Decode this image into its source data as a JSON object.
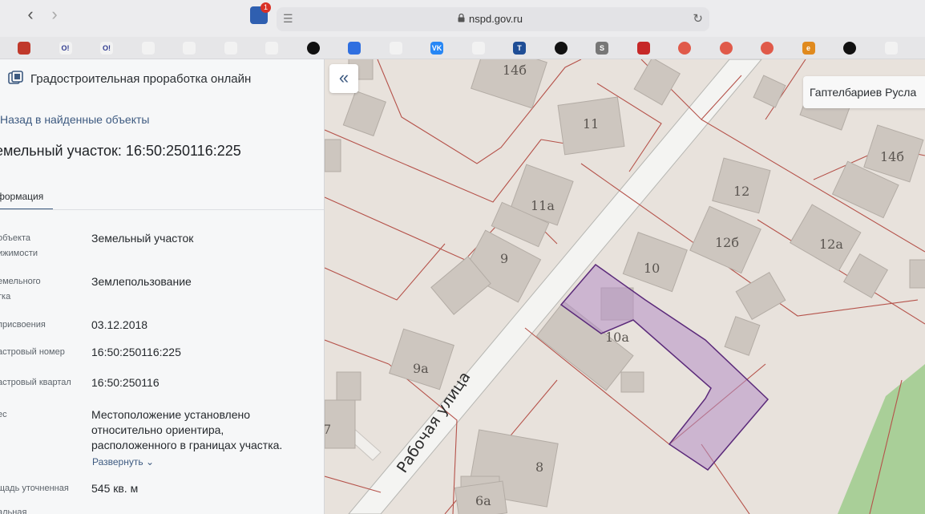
{
  "browser": {
    "url": "nspd.gov.ru",
    "extension_badge": "1",
    "bookmarks": [
      {
        "icon": "red-bookmark-icon",
        "color": "#c0392b",
        "text": ""
      },
      {
        "icon": "ok-icon",
        "color": "#f2f2f2",
        "text": "О!"
      },
      {
        "icon": "ok-green-icon",
        "color": "#f2f2f2",
        "text": "О!"
      },
      {
        "icon": "lambda-blue-icon",
        "color": "#f2f2f2",
        "text": ""
      },
      {
        "icon": "lambda-blue-icon",
        "color": "#f2f2f2",
        "text": ""
      },
      {
        "icon": "dots-colored-icon",
        "color": "#f2f2f2",
        "text": ""
      },
      {
        "icon": "dots-colored-icon",
        "color": "#f2f2f2",
        "text": ""
      },
      {
        "icon": "black-circle-icon",
        "color": "#111111",
        "text": ""
      },
      {
        "icon": "mail-icon",
        "color": "#2f6fe0",
        "text": ""
      },
      {
        "icon": "arrow-icon",
        "color": "#f2f2f2",
        "text": ""
      },
      {
        "icon": "vk-icon",
        "color": "#2787f5",
        "text": "VK"
      },
      {
        "icon": "dots-colored-icon",
        "color": "#f2f2f2",
        "text": ""
      },
      {
        "icon": "t-icon",
        "color": "#1f4e96",
        "text": "T"
      },
      {
        "icon": "black-circle-icon",
        "color": "#111111",
        "text": ""
      },
      {
        "icon": "s-icon",
        "color": "#777777",
        "text": "S"
      },
      {
        "icon": "red-square-icon",
        "color": "#c62828",
        "text": ""
      },
      {
        "icon": "lifebuoy-icon",
        "color": "#e05a4a",
        "text": ""
      },
      {
        "icon": "lifebuoy-icon",
        "color": "#e05a4a",
        "text": ""
      },
      {
        "icon": "lifebuoy-icon",
        "color": "#e05a4a",
        "text": ""
      },
      {
        "icon": "e-icon",
        "color": "#e08a1e",
        "text": "e"
      },
      {
        "icon": "black-circle-icon",
        "color": "#111111",
        "text": ""
      },
      {
        "icon": "arrow-red-icon",
        "color": "#f2f2f2",
        "text": ""
      }
    ]
  },
  "panel": {
    "app_title": "Градостроительная проработка онлайн",
    "back_link": "Назад в найденные объекты",
    "heading": "емельный участок: 16:50:250116:225",
    "tab": "формация",
    "rows": [
      {
        "label": "объекта\nижимости",
        "value": "Земельный участок"
      },
      {
        "label": "емельного\nтка",
        "value": "Землепользование"
      },
      {
        "label": "присвоения",
        "value": "03.12.2018"
      },
      {
        "label": "астровый номер",
        "value": "16:50:250116:225"
      },
      {
        "label": "астровый квартал",
        "value": "16:50:250116"
      },
      {
        "label": "ес",
        "value": "Местоположение установлено\nотносительно ориентира,\nрасположенного в границах участка."
      },
      {
        "label": "щадь уточненная",
        "value": "545 кв. м"
      },
      {
        "label": "альная",
        "value": ""
      }
    ],
    "expand_label": "Развернуть"
  },
  "map": {
    "collapse_label": "«",
    "user_name": "Гаптелбариев Русла",
    "street_label": "Рабочая улица",
    "house_labels": [
      "14б",
      "11",
      "11а",
      "9",
      "9а",
      "7",
      "8",
      "6а",
      "10",
      "10а",
      "12",
      "12б",
      "12а",
      "14б"
    ],
    "highlight_color": "#b48fc6",
    "parcel_line_color": "#b5524a"
  }
}
